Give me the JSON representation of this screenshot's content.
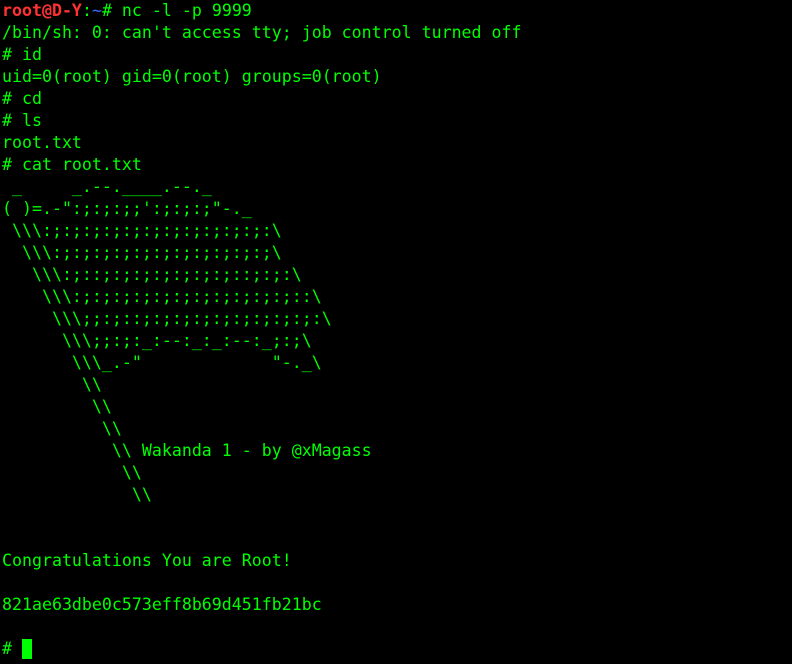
{
  "terminal": {
    "prompt": {
      "user": "root@D-Y",
      "sep": ":",
      "path": "~",
      "symbol": "# ",
      "command": "nc -l -p 9999"
    },
    "lines": [
      "/bin/sh: 0: can't access tty; job control turned off",
      "# id",
      "uid=0(root) gid=0(root) groups=0(root)",
      "# cd",
      "# ls",
      "root.txt",
      "# cat root.txt"
    ],
    "ascii_art": [
      " _     _.--.____.--._",
      "( )=.-\":;:;:;;':;:;:;\"-._",
      " \\\\\\:;:;:;:;:;:;:;:;:;:;:;:\\",
      "  \\\\\\:;:;:;:;:;:;:;:;:;:;:;\\",
      "   \\\\\\:;::;:;:;:;:;:;:;::;:;:\\",
      "    \\\\\\:;:;:;:;:;:;:;:;:;:;:;::\\",
      "     \\\\\\;;:;::;:;:;:;:;:;:;:;:;:\\",
      "      \\\\\\;;:;:_:--:_:_:--:_;:;\\",
      "       \\\\\\_.-\"             \"-._\\",
      "        \\\\",
      "         \\\\",
      "          \\\\",
      "           \\\\ Wakanda 1 - by @xMagass",
      "            \\\\",
      "             \\\\"
    ],
    "congrats": "Congratulations You are Root!",
    "flag": "821ae63dbe0c573eff8b69d451fb21bc",
    "final_prompt": "# "
  }
}
